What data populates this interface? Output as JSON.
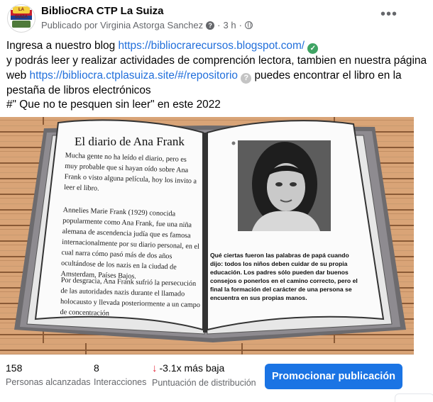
{
  "header": {
    "page_name": "BiblioCRA CTP La Suiza",
    "published_by": "Publicado por Virginia Astorga Sanchez",
    "separator": "·",
    "time": "3 h",
    "separator2": "·",
    "avatar_badge": "LA SUIZA",
    "more_label": "•••"
  },
  "post": {
    "line1_prefix": "Ingresa a nuestro blog ",
    "blog_link": "https://bibliocrarecursos.blogspot.com/",
    "line2": "y podrás leer y realizar actividades de comprención lectora, tambien en nuestra página web ",
    "web_link": "https://bibliocra.ctplasuiza.site/#/repositorio",
    "line3": " puedes encontrar el libro en la pestaña de libros electrónicos",
    "line4": "#\" Que no te pesquen sin leer\" en este 2022",
    "check_icon_glyph": "✓",
    "question_icon_glyph": "?"
  },
  "image": {
    "book_title": "El diario de Ana Frank",
    "para1": "Mucha gente no ha leído el diario, pero es muy probable que si hayan oído sobre Ana Frank o visto alguna película, hoy los invito a leer el libro.",
    "para2": "Annelies Marie Frank (1929) conocida popularmente como Ana Frank, fue una niña alemana de ascendencia judía que es famosa internacionalmente por su diario personal, en el cual narra cómo pasó más de dos años ocultándose de los nazis en la ciudad de Amsterdam, Países Bajos.",
    "para3": "Por desgracia, Ana Frank sufrió la persecución de las autoridades nazis durante el llamado holocausto y llevada posteriormente a un campo de concentración",
    "quote": "Qué ciertas fueron las palabras de papá cuando dijo: todos los niños deben cuidar de su propia educación. Los padres sólo pueden dar buenos consejos o ponerlos en el camino correcto, pero el final la formación del carácter de una persona se encuentra en sus propias manos."
  },
  "stats": {
    "reach_value": "158",
    "reach_label": "Personas alcanzadas",
    "interactions_value": "8",
    "interactions_label": "Interacciones",
    "score_arrow": "↓",
    "score_value": "-3.1x más baja",
    "score_label": "Puntuación de distribución",
    "promote_label": "Promocionar publicación"
  },
  "colors": {
    "link": "#216fdb",
    "promote": "#1b74e4",
    "down": "#e4263a",
    "verified": "#3fa464"
  }
}
